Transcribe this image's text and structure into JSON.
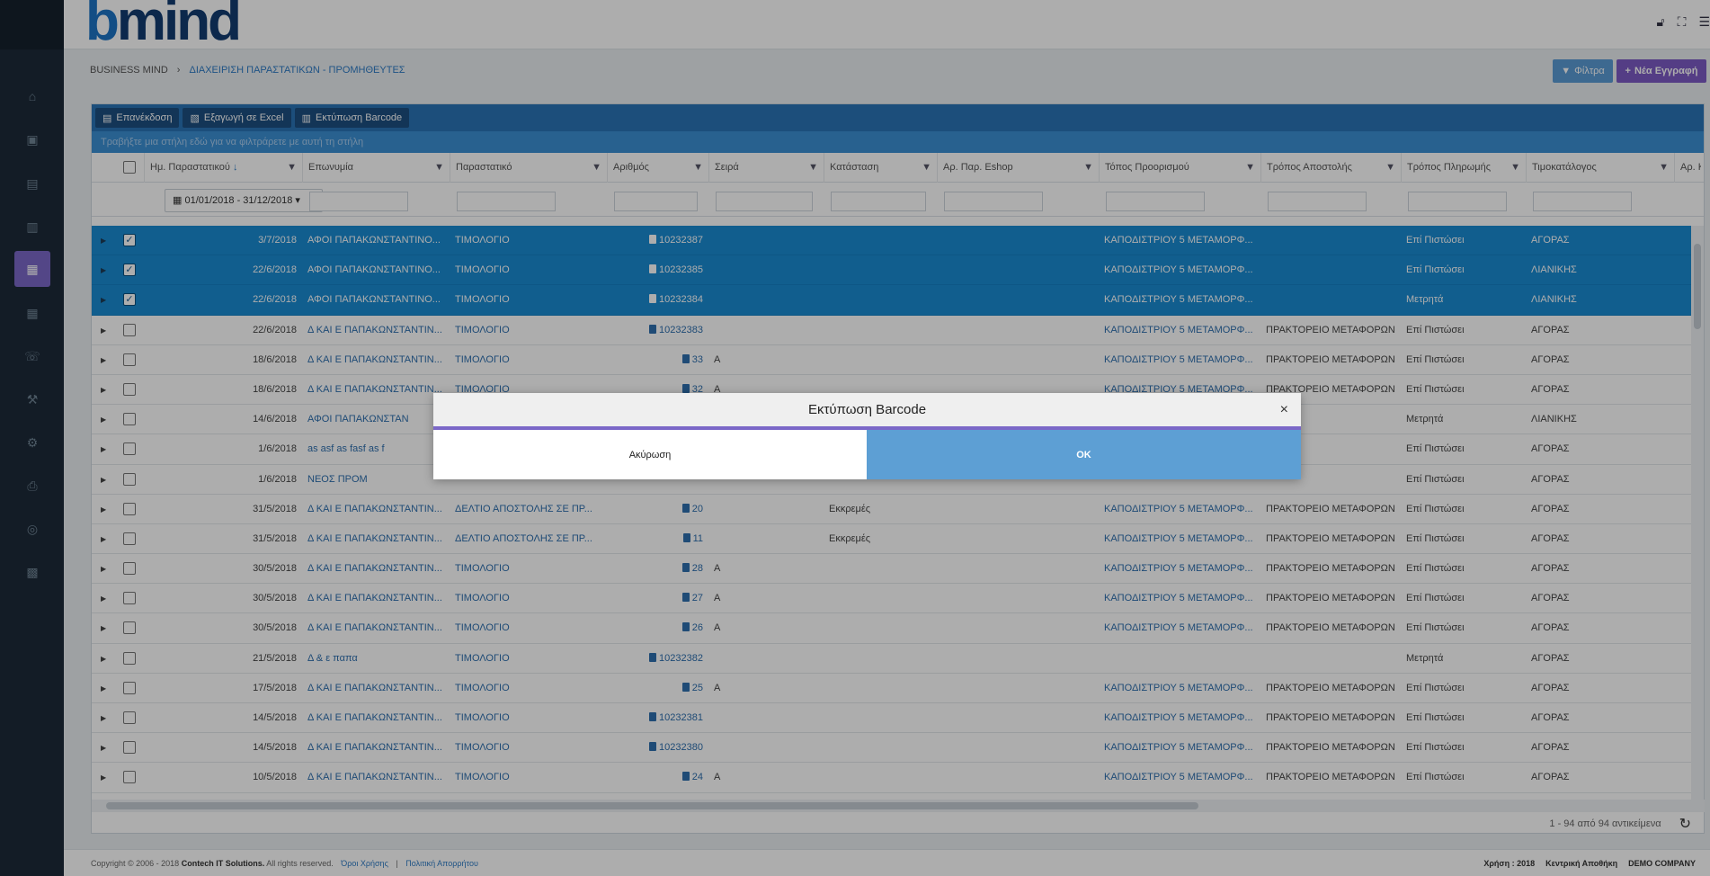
{
  "app": {
    "logo_b": "b",
    "logo_rest": "mind"
  },
  "header_icons": [
    "lock-icon",
    "fullscreen-icon",
    "menu-icon"
  ],
  "breadcrumb": {
    "root": "BUSINESS MIND",
    "sep": "›",
    "current": "ΔΙΑΧΕΙΡΙΣΗ ΠΑΡΑΣΤΑΤΙΚΩΝ - ΠΡΟΜΗΘΕΥΤΕΣ"
  },
  "actions": {
    "filter_label": "Φίλτρα",
    "new_label": "Νέα Εγγραφή"
  },
  "toolbar": {
    "reissue_label": "Επανέκδοση",
    "excel_label": "Εξαγωγή σε Excel",
    "barcode_label": "Εκτύπωση Barcode"
  },
  "group_hint": "Τραβήξτε μια στήλη εδώ για να φιλτράρετε με αυτή τη στήλη",
  "columns": [
    "Ημ. Παραστατικού",
    "Επωνυμία",
    "Παραστατικό",
    "Αριθμός",
    "Σειρά",
    "Κατάσταση",
    "Αρ. Παρ. Eshop",
    "Τόπος Προορισμού",
    "Τρόπος Αποστολής",
    "Τρόπος Πληρωμής",
    "Τιμοκατάλογος",
    "Αρ. Κ"
  ],
  "date_filter": "01/01/2018 - 31/12/2018",
  "rows": [
    {
      "selected": true,
      "date": "3/7/2018",
      "name": "ΑΦΟΙ ΠΑΠΑΚΩΝΣΤΑΝΤΙΝΟ...",
      "doc": "ΤΙΜΟΛΟΓΙΟ",
      "num": "10232387",
      "series": "",
      "status": "",
      "eshop": "",
      "dest": "ΚΑΠΟΔΙΣΤΡΙΟΥ 5 ΜΕΤΑΜΟΡΦ...",
      "ship": "",
      "pay": "Επί Πιστώσει",
      "price": "ΑΓΟΡΑΣ"
    },
    {
      "selected": true,
      "date": "22/6/2018",
      "name": "ΑΦΟΙ ΠΑΠΑΚΩΝΣΤΑΝΤΙΝΟ...",
      "doc": "ΤΙΜΟΛΟΓΙΟ",
      "num": "10232385",
      "series": "",
      "status": "",
      "eshop": "",
      "dest": "ΚΑΠΟΔΙΣΤΡΙΟΥ 5 ΜΕΤΑΜΟΡΦ...",
      "ship": "",
      "pay": "Επί Πιστώσει",
      "price": "ΛΙΑΝΙΚΗΣ"
    },
    {
      "selected": true,
      "date": "22/6/2018",
      "name": "ΑΦΟΙ ΠΑΠΑΚΩΝΣΤΑΝΤΙΝΟ...",
      "doc": "ΤΙΜΟΛΟΓΙΟ",
      "num": "10232384",
      "series": "",
      "status": "",
      "eshop": "",
      "dest": "ΚΑΠΟΔΙΣΤΡΙΟΥ 5 ΜΕΤΑΜΟΡΦ...",
      "ship": "",
      "pay": "Μετρητά",
      "price": "ΛΙΑΝΙΚΗΣ"
    },
    {
      "selected": false,
      "date": "22/6/2018",
      "name": "Δ ΚΑΙ Ε ΠΑΠΑΚΩΝΣΤΑΝΤΙΝ...",
      "doc": "ΤΙΜΟΛΟΓΙΟ",
      "num": "10232383",
      "series": "",
      "status": "",
      "eshop": "",
      "dest": "ΚΑΠΟΔΙΣΤΡΙΟΥ 5 ΜΕΤΑΜΟΡΦ...",
      "ship": "ΠΡΑΚΤΟΡΕΙΟ ΜΕΤΑΦΟΡΩΝ",
      "pay": "Επί Πιστώσει",
      "price": "ΑΓΟΡΑΣ"
    },
    {
      "selected": false,
      "date": "18/6/2018",
      "name": "Δ ΚΑΙ Ε ΠΑΠΑΚΩΝΣΤΑΝΤΙΝ...",
      "doc": "ΤΙΜΟΛΟΓΙΟ",
      "num": "33",
      "series": "Α",
      "status": "",
      "eshop": "",
      "dest": "ΚΑΠΟΔΙΣΤΡΙΟΥ 5 ΜΕΤΑΜΟΡΦ...",
      "ship": "ΠΡΑΚΤΟΡΕΙΟ ΜΕΤΑΦΟΡΩΝ",
      "pay": "Επί Πιστώσει",
      "price": "ΑΓΟΡΑΣ"
    },
    {
      "selected": false,
      "date": "18/6/2018",
      "name": "Δ ΚΑΙ Ε ΠΑΠΑΚΩΝΣΤΑΝΤΙΝ...",
      "doc": "ΤΙΜΟΛΟΓΙΟ",
      "num": "32",
      "series": "Α",
      "status": "",
      "eshop": "",
      "dest": "ΚΑΠΟΔΙΣΤΡΙΟΥ 5 ΜΕΤΑΜΟΡΦ...",
      "ship": "ΠΡΑΚΤΟΡΕΙΟ ΜΕΤΑΦΟΡΩΝ",
      "pay": "Επί Πιστώσει",
      "price": "ΑΓΟΡΑΣ"
    },
    {
      "selected": false,
      "date": "14/6/2018",
      "name": "ΑΦΟΙ ΠΑΠΑΚΩΝΣΤΑΝ",
      "doc": "",
      "num": "",
      "series": "",
      "status": "",
      "eshop": "",
      "dest": "",
      "ship": "",
      "pay": "Μετρητά",
      "price": "ΛΙΑΝΙΚΗΣ"
    },
    {
      "selected": false,
      "date": "1/6/2018",
      "name": "as asf as fasf as f",
      "doc": "",
      "num": "",
      "series": "",
      "status": "",
      "eshop": "",
      "dest": "",
      "ship": "",
      "pay": "Επί Πιστώσει",
      "price": "ΑΓΟΡΑΣ"
    },
    {
      "selected": false,
      "date": "1/6/2018",
      "name": "ΝΕΟΣ ΠΡΟΜ",
      "doc": "",
      "num": "",
      "series": "",
      "status": "",
      "eshop": "",
      "dest": "",
      "ship": "",
      "pay": "Επί Πιστώσει",
      "price": "ΑΓΟΡΑΣ"
    },
    {
      "selected": false,
      "date": "31/5/2018",
      "name": "Δ ΚΑΙ Ε ΠΑΠΑΚΩΝΣΤΑΝΤΙΝ...",
      "doc": "ΔΕΛΤΙΟ ΑΠΟΣΤΟΛΗΣ ΣΕ ΠΡ...",
      "num": "20",
      "series": "",
      "status": "Εκκρεμές",
      "eshop": "",
      "dest": "ΚΑΠΟΔΙΣΤΡΙΟΥ 5 ΜΕΤΑΜΟΡΦ...",
      "ship": "ΠΡΑΚΤΟΡΕΙΟ ΜΕΤΑΦΟΡΩΝ",
      "pay": "Επί Πιστώσει",
      "price": "ΑΓΟΡΑΣ"
    },
    {
      "selected": false,
      "date": "31/5/2018",
      "name": "Δ ΚΑΙ Ε ΠΑΠΑΚΩΝΣΤΑΝΤΙΝ...",
      "doc": "ΔΕΛΤΙΟ ΑΠΟΣΤΟΛΗΣ ΣΕ ΠΡ...",
      "num": "11",
      "series": "",
      "status": "Εκκρεμές",
      "eshop": "",
      "dest": "ΚΑΠΟΔΙΣΤΡΙΟΥ 5 ΜΕΤΑΜΟΡΦ...",
      "ship": "ΠΡΑΚΤΟΡΕΙΟ ΜΕΤΑΦΟΡΩΝ",
      "pay": "Επί Πιστώσει",
      "price": "ΑΓΟΡΑΣ"
    },
    {
      "selected": false,
      "date": "30/5/2018",
      "name": "Δ ΚΑΙ Ε ΠΑΠΑΚΩΝΣΤΑΝΤΙΝ...",
      "doc": "ΤΙΜΟΛΟΓΙΟ",
      "num": "28",
      "series": "Α",
      "status": "",
      "eshop": "",
      "dest": "ΚΑΠΟΔΙΣΤΡΙΟΥ 5 ΜΕΤΑΜΟΡΦ...",
      "ship": "ΠΡΑΚΤΟΡΕΙΟ ΜΕΤΑΦΟΡΩΝ",
      "pay": "Επί Πιστώσει",
      "price": "ΑΓΟΡΑΣ"
    },
    {
      "selected": false,
      "date": "30/5/2018",
      "name": "Δ ΚΑΙ Ε ΠΑΠΑΚΩΝΣΤΑΝΤΙΝ...",
      "doc": "ΤΙΜΟΛΟΓΙΟ",
      "num": "27",
      "series": "Α",
      "status": "",
      "eshop": "",
      "dest": "ΚΑΠΟΔΙΣΤΡΙΟΥ 5 ΜΕΤΑΜΟΡΦ...",
      "ship": "ΠΡΑΚΤΟΡΕΙΟ ΜΕΤΑΦΟΡΩΝ",
      "pay": "Επί Πιστώσει",
      "price": "ΑΓΟΡΑΣ"
    },
    {
      "selected": false,
      "date": "30/5/2018",
      "name": "Δ ΚΑΙ Ε ΠΑΠΑΚΩΝΣΤΑΝΤΙΝ...",
      "doc": "ΤΙΜΟΛΟΓΙΟ",
      "num": "26",
      "series": "Α",
      "status": "",
      "eshop": "",
      "dest": "ΚΑΠΟΔΙΣΤΡΙΟΥ 5 ΜΕΤΑΜΟΡΦ...",
      "ship": "ΠΡΑΚΤΟΡΕΙΟ ΜΕΤΑΦΟΡΩΝ",
      "pay": "Επί Πιστώσει",
      "price": "ΑΓΟΡΑΣ"
    },
    {
      "selected": false,
      "date": "21/5/2018",
      "name": "Δ & ε παπα",
      "doc": "ΤΙΜΟΛΟΓΙΟ",
      "num": "10232382",
      "series": "",
      "status": "",
      "eshop": "",
      "dest": "",
      "ship": "",
      "pay": "Μετρητά",
      "price": "ΑΓΟΡΑΣ"
    },
    {
      "selected": false,
      "date": "17/5/2018",
      "name": "Δ ΚΑΙ Ε ΠΑΠΑΚΩΝΣΤΑΝΤΙΝ...",
      "doc": "ΤΙΜΟΛΟΓΙΟ",
      "num": "25",
      "series": "Α",
      "status": "",
      "eshop": "",
      "dest": "ΚΑΠΟΔΙΣΤΡΙΟΥ 5 ΜΕΤΑΜΟΡΦ...",
      "ship": "ΠΡΑΚΤΟΡΕΙΟ ΜΕΤΑΦΟΡΩΝ",
      "pay": "Επί Πιστώσει",
      "price": "ΑΓΟΡΑΣ"
    },
    {
      "selected": false,
      "date": "14/5/2018",
      "name": "Δ ΚΑΙ Ε ΠΑΠΑΚΩΝΣΤΑΝΤΙΝ...",
      "doc": "ΤΙΜΟΛΟΓΙΟ",
      "num": "10232381",
      "series": "",
      "status": "",
      "eshop": "",
      "dest": "ΚΑΠΟΔΙΣΤΡΙΟΥ 5 ΜΕΤΑΜΟΡΦ...",
      "ship": "ΠΡΑΚΤΟΡΕΙΟ ΜΕΤΑΦΟΡΩΝ",
      "pay": "Επί Πιστώσει",
      "price": "ΑΓΟΡΑΣ"
    },
    {
      "selected": false,
      "date": "14/5/2018",
      "name": "Δ ΚΑΙ Ε ΠΑΠΑΚΩΝΣΤΑΝΤΙΝ...",
      "doc": "ΤΙΜΟΛΟΓΙΟ",
      "num": "10232380",
      "series": "",
      "status": "",
      "eshop": "",
      "dest": "ΚΑΠΟΔΙΣΤΡΙΟΥ 5 ΜΕΤΑΜΟΡΦ...",
      "ship": "ΠΡΑΚΤΟΡΕΙΟ ΜΕΤΑΦΟΡΩΝ",
      "pay": "Επί Πιστώσει",
      "price": "ΑΓΟΡΑΣ"
    },
    {
      "selected": false,
      "date": "10/5/2018",
      "name": "Δ ΚΑΙ Ε ΠΑΠΑΚΩΝΣΤΑΝΤΙΝ...",
      "doc": "ΤΙΜΟΛΟΓΙΟ",
      "num": "24",
      "series": "Α",
      "status": "",
      "eshop": "",
      "dest": "ΚΑΠΟΔΙΣΤΡΙΟΥ 5 ΜΕΤΑΜΟΡΦ...",
      "ship": "ΠΡΑΚΤΟΡΕΙΟ ΜΕΤΑΦΟΡΩΝ",
      "pay": "Επί Πιστώσει",
      "price": "ΑΓΟΡΑΣ"
    }
  ],
  "pager": {
    "summary": "1 - 94 από 94 αντικείμενα"
  },
  "footer": {
    "copyright": "Copyright © 2006 - 2018",
    "company": "Contech IT Solutions.",
    "rights": "All rights reserved.",
    "terms": "Όροι Χρήσης",
    "sep": "|",
    "privacy": "Πολιτική Απορρήτου",
    "year": "Χρήση : 2018",
    "warehouse": "Κεντρική Αποθήκη",
    "demo": "DEMO COMPANY"
  },
  "modal": {
    "title": "Εκτύπωση Barcode",
    "close": "×",
    "cancel_label": "Ακύρωση",
    "ok_label": "OK"
  },
  "colors": {
    "sidebar": "#1c2a38",
    "accent": "#7b68c8",
    "selected_row": "#1a8bd2",
    "toolbar": "#2a73b5",
    "ok": "#5d9fd4"
  }
}
